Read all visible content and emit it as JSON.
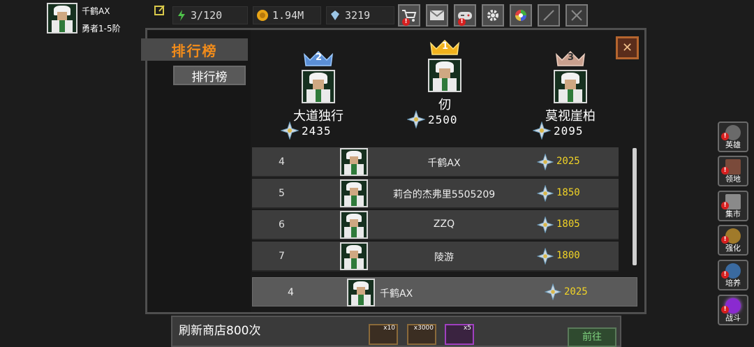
{
  "player": {
    "name": "千鹤AX",
    "rank": "勇者1-5阶"
  },
  "stats": {
    "energy": "3/120",
    "gold": "1.94M",
    "gems": "3219"
  },
  "toolbar_icons": [
    "shop-cart-icon",
    "mail-icon",
    "gamepad-icon",
    "gear-icon",
    "color-wheel-icon",
    "feather-icon",
    "crossed-swords-icon"
  ],
  "tabs": {
    "main": "排行榜",
    "sub": "排行榜"
  },
  "podium": [
    {
      "place": "2",
      "name": "大道独行",
      "score": "2435"
    },
    {
      "place": "1",
      "name": "仞",
      "score": "2500"
    },
    {
      "place": "3",
      "name": "莫视崖柏",
      "score": "2095"
    }
  ],
  "rows": [
    {
      "rank": "4",
      "name": "千鹤AX",
      "score": "2025"
    },
    {
      "rank": "5",
      "name": "莉合的杰弗里5505209",
      "score": "1850"
    },
    {
      "rank": "6",
      "name": "ZZQ",
      "score": "1805"
    },
    {
      "rank": "7",
      "name": "陵游",
      "score": "1800"
    }
  ],
  "self_row": {
    "rank": "4",
    "name": "千鹤AX",
    "score": "2025"
  },
  "side_menu": [
    {
      "label": "英雄",
      "icon": "helmet-icon"
    },
    {
      "label": "领地",
      "icon": "territory-icon"
    },
    {
      "label": "集市",
      "icon": "market-icon"
    },
    {
      "label": "强化",
      "icon": "enhance-icon"
    },
    {
      "label": "培养",
      "icon": "cultivate-icon"
    },
    {
      "label": "战斗",
      "icon": "battle-portal-icon"
    }
  ],
  "bottom": {
    "task": "刷新商店800次",
    "reward1": "x10",
    "reward2": "x3000",
    "reward3": "x5",
    "go": "前往"
  },
  "colors": {
    "accent_orange": "#f28c1a",
    "score_yellow": "#f2d426",
    "close_border": "#b5652e"
  }
}
